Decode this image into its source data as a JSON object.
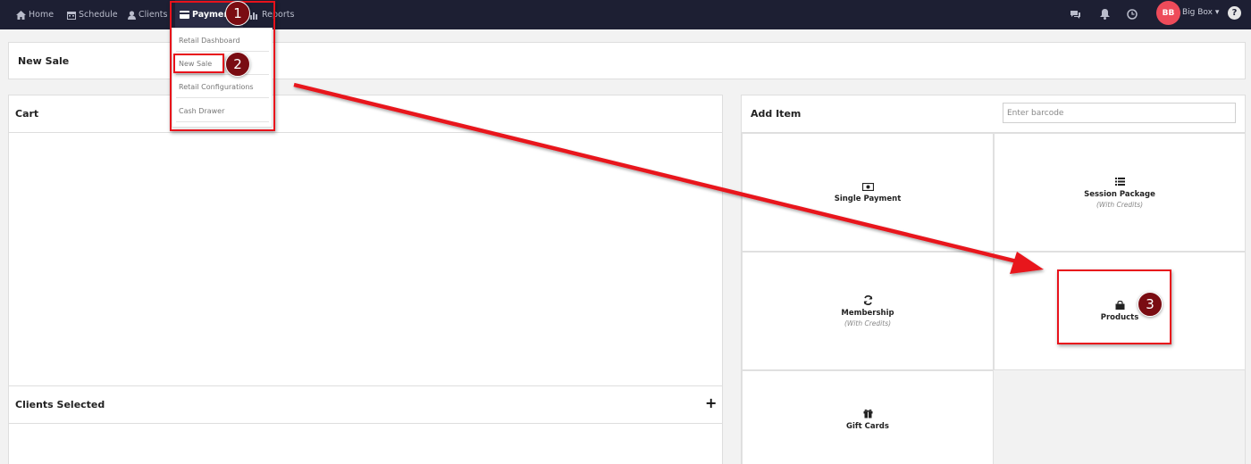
{
  "nav": {
    "items": [
      {
        "label": "Home",
        "icon": "home-icon"
      },
      {
        "label": "Schedule",
        "icon": "calendar-icon"
      },
      {
        "label": "Clients",
        "icon": "user-icon"
      },
      {
        "label": "Payments",
        "icon": "credit-card-icon"
      },
      {
        "label": "Reports",
        "icon": "bar-chart-icon"
      }
    ],
    "right_icons": [
      "chat-icon",
      "bell-icon",
      "clock-icon"
    ],
    "user": {
      "initials": "BB",
      "name": "Big Box ▾"
    },
    "help_label": "?"
  },
  "payments_menu": {
    "items": [
      "Retail Dashboard",
      "New Sale",
      "Retail Configurations",
      "Cash Drawer"
    ]
  },
  "page": {
    "title": "New Sale"
  },
  "cart": {
    "title": "Cart"
  },
  "clients_selected": {
    "title": "Clients Selected",
    "add_label": "+"
  },
  "add_item": {
    "title": "Add Item",
    "barcode_placeholder": "Enter barcode",
    "tiles": [
      {
        "label": "Single Payment",
        "sub": "",
        "icon": "money-icon"
      },
      {
        "label": "Session Package",
        "sub": "(With Credits)",
        "icon": "list-icon"
      },
      {
        "label": "Membership",
        "sub": "(With Credits)",
        "icon": "refresh-icon"
      },
      {
        "label": "Products",
        "sub": "",
        "icon": "shopping-bag-icon"
      },
      {
        "label": "Gift Cards",
        "sub": "",
        "icon": "gift-icon"
      }
    ]
  },
  "annotations": {
    "badges": [
      "1",
      "2",
      "3"
    ],
    "color": "#e8121b"
  },
  "colors": {
    "nav_background": "#1d1f33",
    "avatar": "#ee4b5a",
    "badge": "#7a0c12"
  }
}
